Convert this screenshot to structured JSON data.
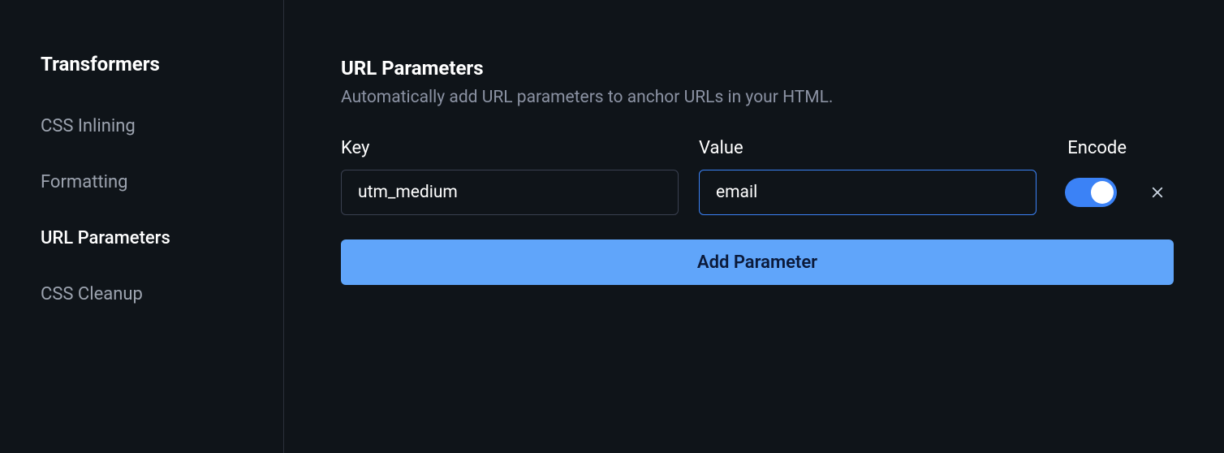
{
  "sidebar": {
    "title": "Transformers",
    "items": [
      {
        "label": "CSS Inlining",
        "active": false
      },
      {
        "label": "Formatting",
        "active": false
      },
      {
        "label": "URL Parameters",
        "active": true
      },
      {
        "label": "CSS Cleanup",
        "active": false
      }
    ]
  },
  "main": {
    "title": "URL Parameters",
    "subtitle": "Automatically add URL parameters to anchor URLs in your HTML.",
    "columns": {
      "key": "Key",
      "value": "Value",
      "encode": "Encode"
    },
    "params": [
      {
        "key": "utm_medium",
        "value": "email",
        "encode": true
      }
    ],
    "add_button_label": "Add Parameter"
  }
}
